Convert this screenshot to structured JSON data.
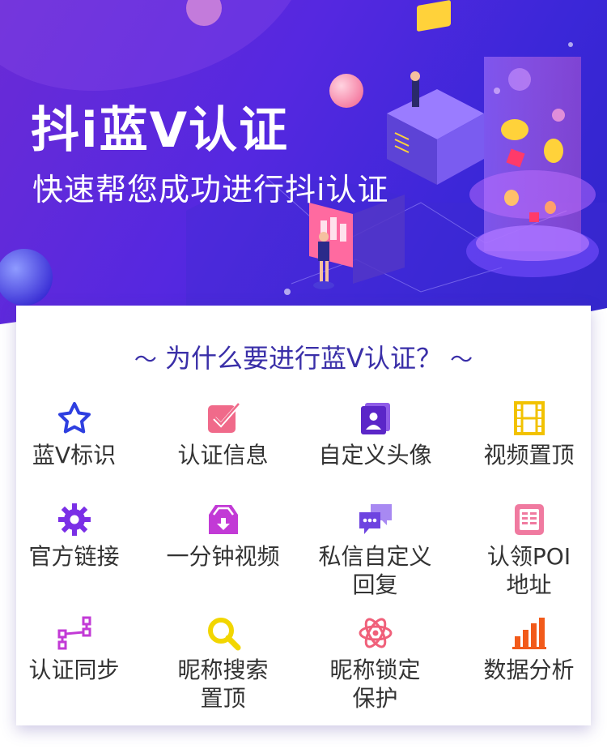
{
  "hero": {
    "title": "抖i蓝V认证",
    "subtitle": "快速帮您成功进行抖i认证"
  },
  "card": {
    "heading_left": "〜",
    "heading": "为什么要进行蓝V认证？",
    "heading_right": "〜",
    "features": [
      {
        "label": "蓝V标识",
        "icon": "star-icon",
        "color": "#2e3fe0"
      },
      {
        "label": "认证信息",
        "icon": "checkbox-icon",
        "color": "#f06a8a"
      },
      {
        "label": "自定义头像",
        "icon": "profile-card-icon",
        "color": "#6a2fd6"
      },
      {
        "label": "视频置顶",
        "icon": "film-icon",
        "color": "#f2c200"
      },
      {
        "label": "官方链接",
        "icon": "gear-icon",
        "color": "#7a2fe6"
      },
      {
        "label": "一分钟视频",
        "icon": "download-box-icon",
        "color": "#c23ad6"
      },
      {
        "label": "私信自定义\n回复",
        "icon": "chat-icon",
        "color": "#7d55e8"
      },
      {
        "label": "认领POI\n地址",
        "icon": "document-icon",
        "color": "#f07aa0"
      },
      {
        "label": "认证同步",
        "icon": "sync-nodes-icon",
        "color": "#c23ad6"
      },
      {
        "label": "昵称搜索\n置顶",
        "icon": "search-icon",
        "color": "#f2d600"
      },
      {
        "label": "昵称锁定\n保护",
        "icon": "atom-icon",
        "color": "#f0607a"
      },
      {
        "label": "数据分析",
        "icon": "bar-chart-icon",
        "color": "#f25a1a"
      }
    ]
  }
}
